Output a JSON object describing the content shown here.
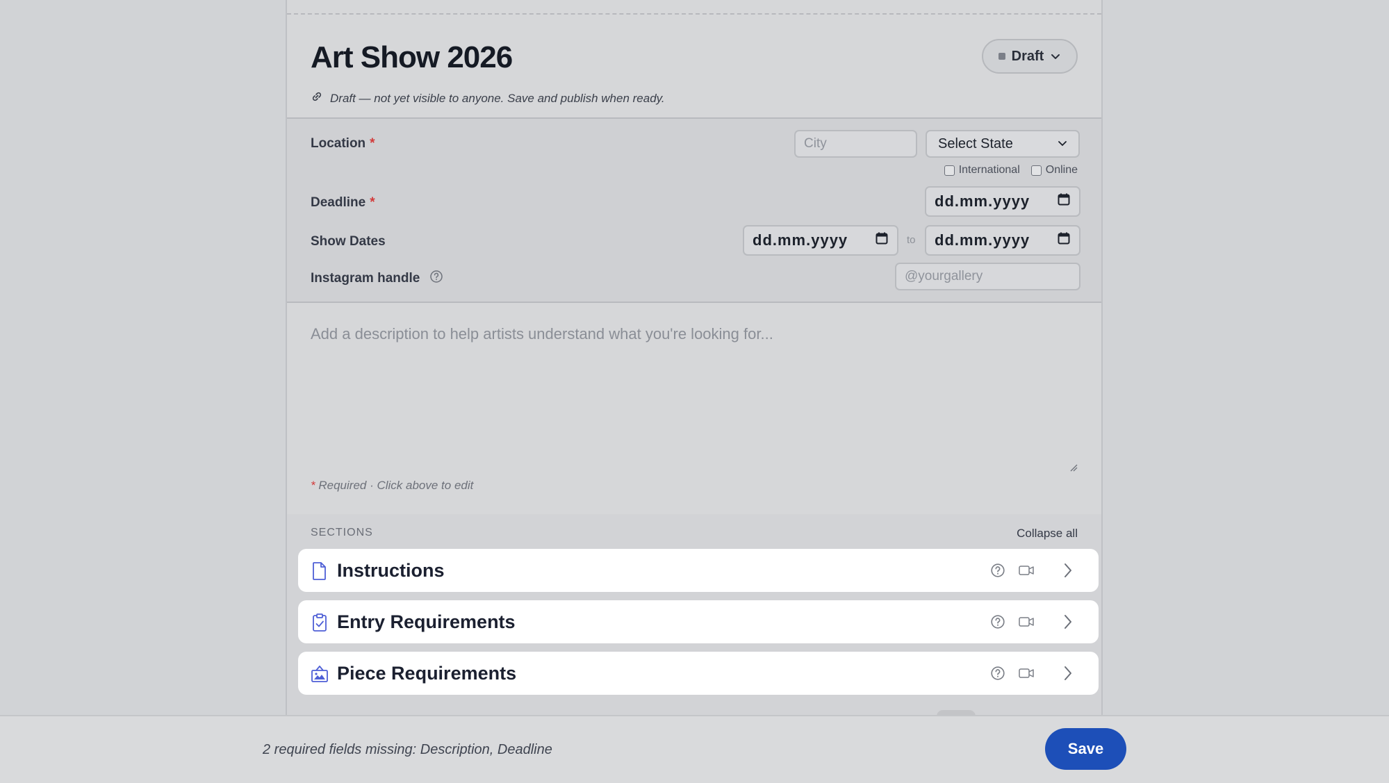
{
  "form": {
    "title": "Art Show 2026",
    "status": "Draft",
    "note": "Draft — not yet visible to anyone. Save and publish when ready."
  },
  "fields": {
    "location_label": "Location",
    "city_placeholder": "City",
    "state_selected": "Select State",
    "international_label": "International",
    "online_label": "Online",
    "deadline_label": "Deadline",
    "date_format": "dd.mm.yyyy",
    "show_dates_label": "Show Dates",
    "to_label": "to",
    "instagram_label": "Instagram handle",
    "instagram_placeholder": "@yourgallery",
    "required_mark": "*"
  },
  "description": {
    "placeholder": "Add a description to help artists understand what you're looking for...",
    "note": "Required · Click above to edit"
  },
  "sections": {
    "heading": "SECTIONS",
    "collapse_all": "Collapse all",
    "items": [
      {
        "label": "Instructions",
        "icon": "document-icon"
      },
      {
        "label": "Entry Requirements",
        "icon": "clipboard-check-icon"
      },
      {
        "label": "Piece Requirements",
        "icon": "gallery-icon"
      }
    ]
  },
  "footer": {
    "missing": "2 required fields missing: Description, Deadline",
    "save_label": "Save"
  },
  "colors": {
    "accent": "#1d4fb8",
    "required": "#d23b3b",
    "icon_accent": "#4e5fd6"
  }
}
